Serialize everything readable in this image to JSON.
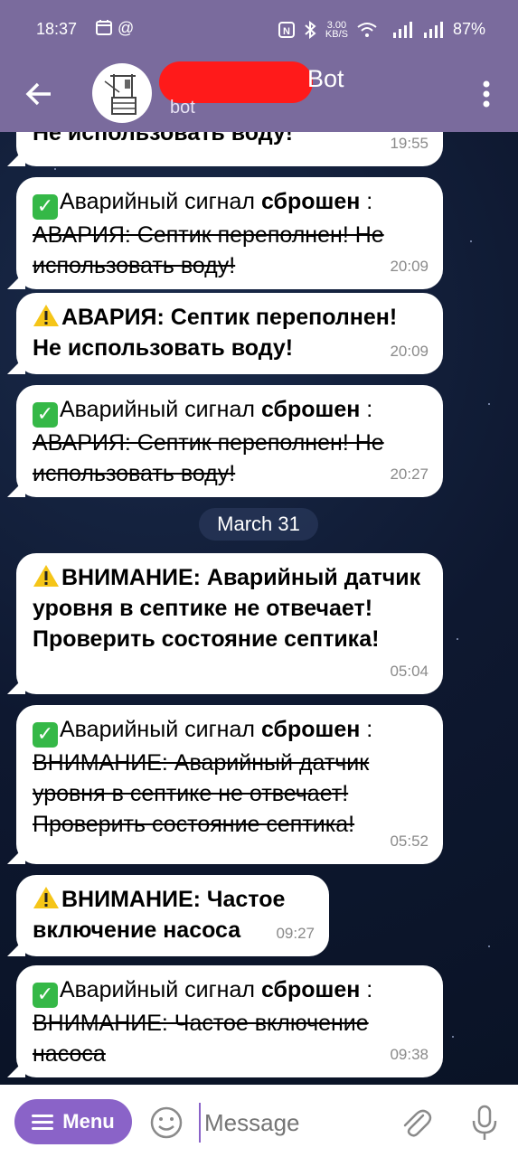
{
  "status_bar": {
    "time": "18:37",
    "speed_top": "3.00",
    "speed_bottom": "KB/S",
    "battery": "87%"
  },
  "header": {
    "title": "Bot",
    "subtitle": "bot",
    "back_icon": "arrow-left-icon",
    "more_icon": "more-vertical-icon"
  },
  "date_separator": "March 31",
  "messages": [
    {
      "line1": "Не использовать воду!",
      "time": "19:55"
    },
    {
      "prefix": "Аварийный сигнал ",
      "bold": "сброшен",
      "colon": " :",
      "strike": "АВАРИЯ: Септик переполнен! Не использовать воду!",
      "time": "20:09"
    },
    {
      "text": "АВАРИЯ: Септик переполнен! Не использовать воду!",
      "time": "20:09"
    },
    {
      "prefix": "Аварийный сигнал ",
      "bold": "сброшен",
      "colon": " :",
      "strike": "АВАРИЯ: Септик переполнен! Не использовать воду!",
      "time": "20:27"
    },
    {
      "text": "ВНИМАНИЕ: Аварийный датчик уровня в септике не отвечает! Проверить состояние септика!",
      "time": "05:04"
    },
    {
      "prefix": "Аварийный сигнал ",
      "bold": "сброшен",
      "colon": " :",
      "strike": "ВНИМАНИЕ: Аварийный датчик уровня в септике не отвечает! Проверить состояние септика!",
      "time": "05:52"
    },
    {
      "text": "ВНИМАНИЕ: Частое включение насоса",
      "time": "09:27"
    },
    {
      "prefix": "Аварийный сигнал ",
      "bold": "сброшен",
      "colon": " :",
      "strike": "ВНИМАНИЕ: Частое включение насоса",
      "time": "09:38"
    }
  ],
  "composer": {
    "menu_label": "Menu",
    "placeholder": "Message"
  },
  "colors": {
    "header": "#7a6b9d",
    "menu_button": "#8a63c8",
    "check_emoji": "#35b847",
    "warning_emoji": "#f5c518"
  }
}
